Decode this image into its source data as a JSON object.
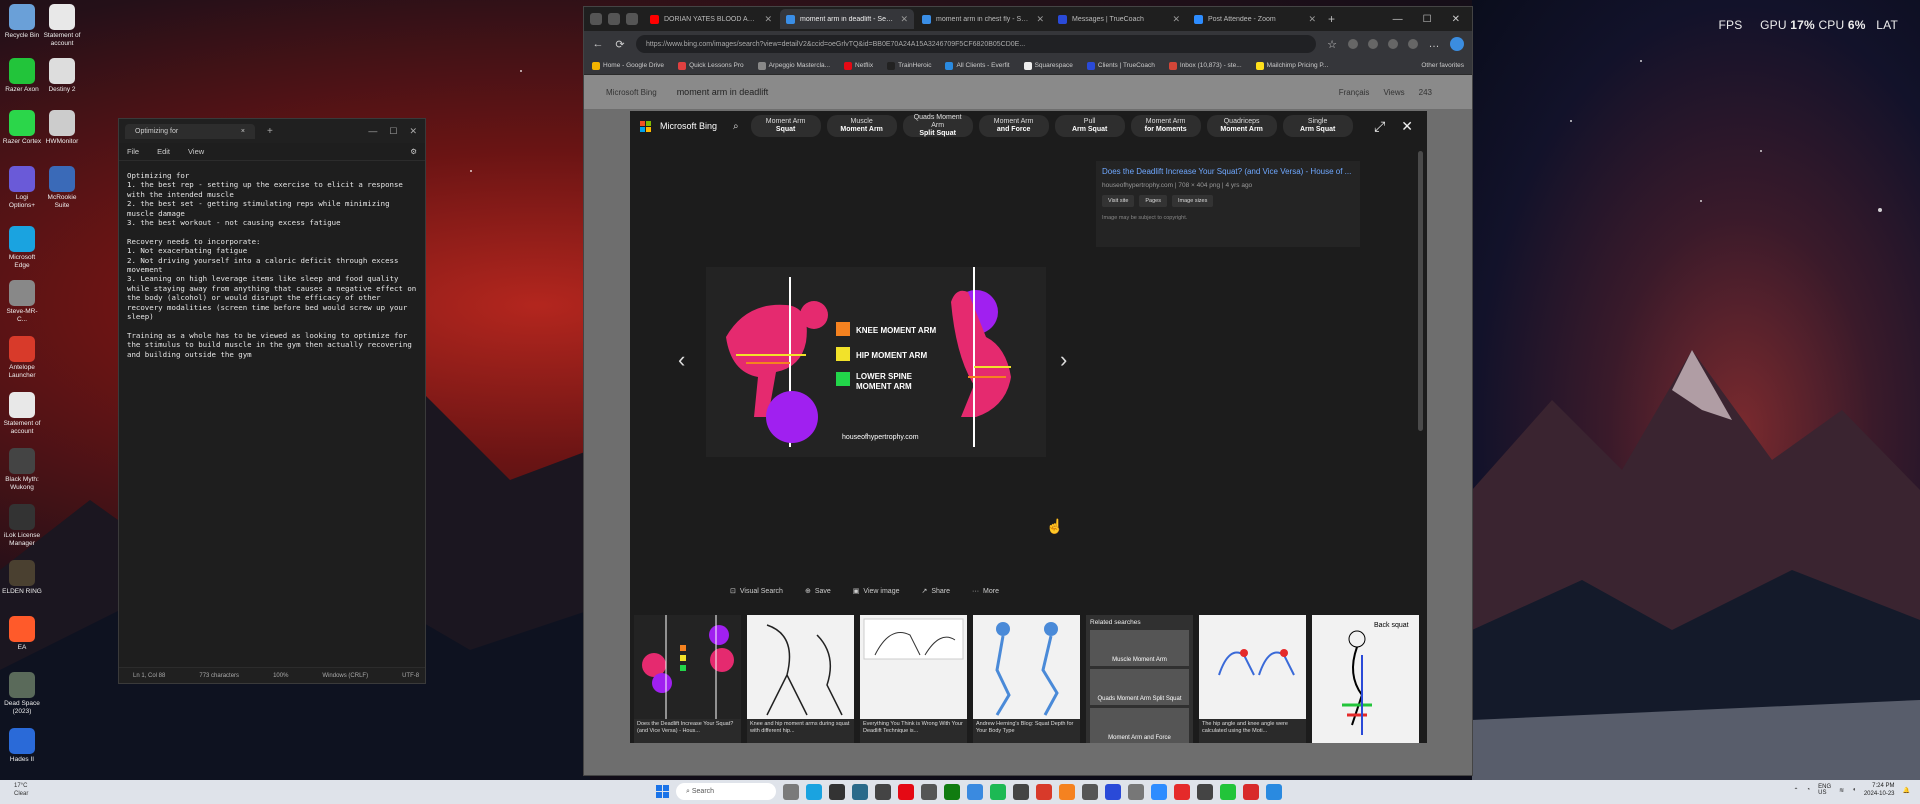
{
  "overlay": {
    "fps_label": "FPS",
    "gpu_label": "GPU",
    "gpu_val": "17%",
    "cpu_label": "CPU",
    "cpu_val": "6%",
    "lat_label": "LAT"
  },
  "desktop_icons": [
    {
      "label": "Recycle Bin",
      "color": "#6aa0d8"
    },
    {
      "label": "Statement of account",
      "color": "#e8e8e8"
    },
    {
      "label": "Razer Axon",
      "color": "#22c43a"
    },
    {
      "label": "Destiny 2",
      "color": "#dddddd"
    },
    {
      "label": "Razer Cortex",
      "color": "#2bd64a"
    },
    {
      "label": "HWMonitor",
      "color": "#cccccc"
    },
    {
      "label": "Logi Options+",
      "color": "#6a5ad8"
    },
    {
      "label": "McRookie Suite",
      "color": "#3a6ab8"
    },
    {
      "label": "Microsoft Edge",
      "color": "#1aa3e0"
    },
    {
      "label": "Steve-MR-C...",
      "color": "#888888"
    },
    {
      "label": "Antelope Launcher",
      "color": "#d83a2a"
    },
    {
      "label": "Statement of account",
      "color": "#e8e8e8"
    },
    {
      "label": "Black Myth: Wukong",
      "color": "#444444"
    },
    {
      "label": "iLok License Manager",
      "color": "#333333"
    },
    {
      "label": "ELDEN RING",
      "color": "#4a4030"
    },
    {
      "label": "EA",
      "color": "#ff5a2a"
    },
    {
      "label": "Dead Space (2023)",
      "color": "#5a6a5a"
    },
    {
      "label": "Hades II",
      "color": "#2a6ad8"
    }
  ],
  "notepad": {
    "tab_title": "Optimizing for",
    "menu": [
      "File",
      "Edit",
      "View"
    ],
    "text": "Optimizing for\n1. the best rep - setting up the exercise to elicit a response with the intended muscle\n2. the best set - getting stimulating reps while minimizing muscle damage\n3. the best workout - not causing excess fatigue\n\nRecovery needs to incorporate:\n1. Not exacerbating fatigue\n2. Not driving yourself into a caloric deficit through excess movement\n3. Leaning on high leverage items like sleep and food quality while staying away from anything that causes a negative effect on the body (alcohol) or would disrupt the efficacy of other recovery modalities (screen time before bed would screw up your sleep)\n\nTraining as a whole has to be viewed as looking to optimize for the stimulus to build muscle in the gym then actually recovering and building outside the gym",
    "status": [
      "Ln 1, Col 88",
      "773 characters",
      "100%",
      "Windows (CRLF)",
      "UTF-8"
    ]
  },
  "browser": {
    "tabs": [
      {
        "label": "DORIAN YATES BLOOD AND GUTS",
        "fav": "#ff0000",
        "active": false
      },
      {
        "label": "moment arm in deadlift - Search",
        "fav": "#3a8ee6",
        "active": true
      },
      {
        "label": "moment arm in chest fly - Search",
        "fav": "#3a8ee6",
        "active": false
      },
      {
        "label": "Messages | TrueCoach",
        "fav": "#2a4ad8",
        "active": false
      },
      {
        "label": "Post Attendee - Zoom",
        "fav": "#2d8cff",
        "active": false
      }
    ],
    "url": "https://www.bing.com/images/search?view=detailV2&ccid=oeGrlvTQ&id=BB0E70A24A15A3246709F5CF6820B05CD0E...",
    "bookmarks": [
      {
        "label": "Home - Google Drive",
        "color": "#f4b400"
      },
      {
        "label": "Quick Lessons Pro",
        "color": "#e04040"
      },
      {
        "label": "Arpeggio Mastercla...",
        "color": "#888888"
      },
      {
        "label": "Netflix",
        "color": "#e50914"
      },
      {
        "label": "TrainHeroic",
        "color": "#222222"
      },
      {
        "label": "All Clients - Everfit",
        "color": "#2a8ae0"
      },
      {
        "label": "Squarespace",
        "color": "#eeeeee"
      },
      {
        "label": "Clients | TrueCoach",
        "color": "#2a4ad8"
      },
      {
        "label": "Inbox (10,873) - ste...",
        "color": "#d44638"
      },
      {
        "label": "Mailchimp Pricing P...",
        "color": "#ffe01b"
      }
    ],
    "other_bookmarks": "Other favorites",
    "bg_query": "moment arm in deadlift",
    "bg_right": [
      "Français",
      "Views",
      "243"
    ]
  },
  "modal": {
    "brand": "Microsoft Bing",
    "chips": [
      {
        "l1": "Moment Arm",
        "l2": "Squat"
      },
      {
        "l1": "Muscle",
        "l2": "Moment Arm"
      },
      {
        "l1": "Quads Moment Arm",
        "l2": "Split Squat"
      },
      {
        "l1": "Moment Arm",
        "l2": "and Force"
      },
      {
        "l1": "Pull",
        "l2": "Arm Squat"
      },
      {
        "l1": "Moment Arm",
        "l2": "for Moments"
      },
      {
        "l1": "Quadriceps",
        "l2": "Moment Arm"
      },
      {
        "l1": "Single",
        "l2": "Arm Squat"
      }
    ],
    "info": {
      "title": "Does the Deadlift Increase Your Squat? (and Vice Versa) - House of ...",
      "source": "houseofhypertrophy.com",
      "size": "708 × 404 png",
      "age": "4 yrs ago",
      "buttons": [
        "Visit site",
        "Pages",
        "Image sizes"
      ],
      "note": "Image may be subject to copyright."
    },
    "legend": [
      "KNEE MOMENT ARM",
      "HIP MOMENT ARM",
      "LOWER SPINE",
      "MOMENT ARM"
    ],
    "legend_colors": [
      "#f58220",
      "#f2e22a",
      "#22d64a"
    ],
    "watermark": "houseofhypertrophy.com",
    "actions": [
      "Visual Search",
      "Save",
      "View image",
      "Share",
      "More"
    ],
    "thumbs": [
      {
        "cap": "Does the Deadlift Increase Your Squat? (and Vice Versa) - Hous..."
      },
      {
        "cap": "Knee and hip moment arms during squat with different hip..."
      },
      {
        "cap": "Everything You Think is Wrong With Your Deadlift Technique is..."
      },
      {
        "cap": "Andrew Herning's Blog: Squat Depth for Your Body Type"
      }
    ],
    "related_title": "Related searches",
    "related": [
      "Muscle Moment Arm",
      "Quads Moment Arm Split Squat",
      "Moment Arm and Force"
    ],
    "thumb2_caps": [
      "The hip angle and knee angle were calculated using the Moti..."
    ],
    "thumb3_label": "Back squat"
  },
  "taskbar": {
    "weather_temp": "17°C",
    "weather_desc": "Clear",
    "search": "Search",
    "lang": "ENG",
    "region": "US",
    "time": "7:24 PM",
    "date": "2024-10-23"
  }
}
